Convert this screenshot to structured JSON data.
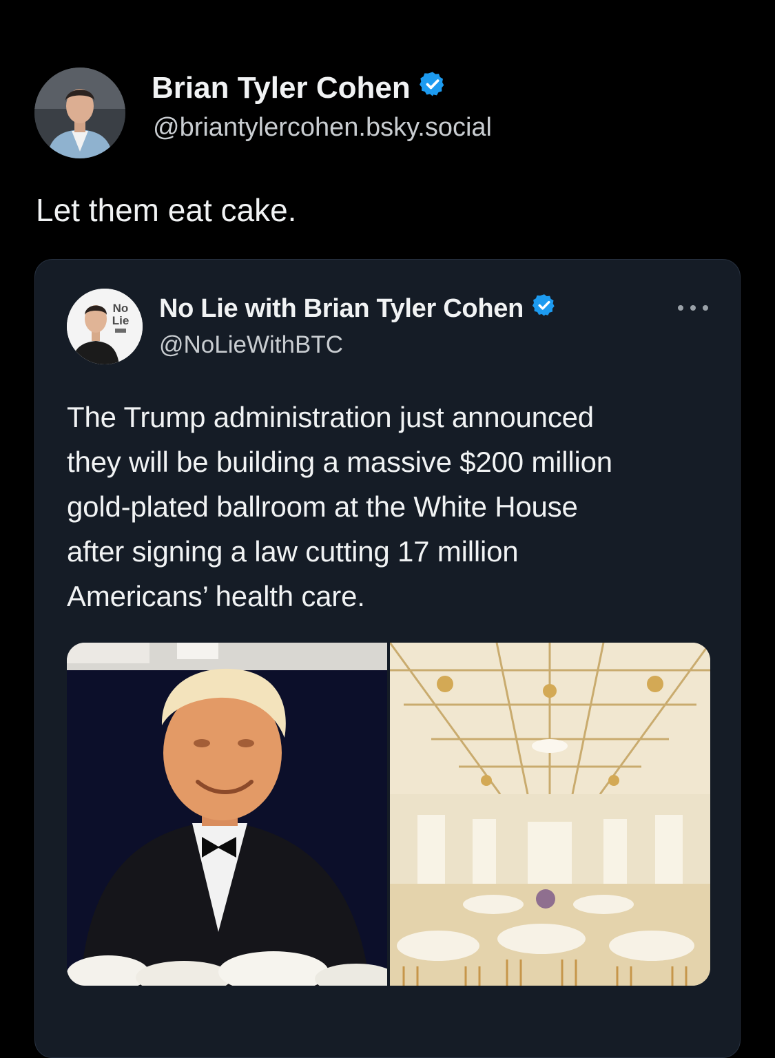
{
  "post": {
    "author": {
      "name": "Brian Tyler Cohen",
      "handle": "@briantylercohen.bsky.social",
      "verified": true,
      "avatar_icon": "profile-photo"
    },
    "text": "Let them eat cake."
  },
  "quoted_post": {
    "author": {
      "name": "No Lie with Brian Tyler Cohen",
      "handle": "@NoLieWithBTC",
      "verified": true,
      "avatar_icon": "no-lie-logo-avatar",
      "avatar_logo_text": "No Lie"
    },
    "more_icon": "more-options-icon",
    "text_lines": [
      "The Trump administration just announced",
      "they will be building a massive $200 million",
      "gold-plated ballroom at the White House",
      "after signing a law cutting 17 million",
      "Americans’ health care."
    ],
    "media": [
      {
        "icon": "photo-man-in-tuxedo"
      },
      {
        "icon": "photo-gold-ballroom"
      }
    ]
  },
  "colors": {
    "background": "#000000",
    "card_background": "#151c26",
    "verified_blue": "#1d9bf0",
    "text_primary": "#f1f3f4",
    "text_secondary": "#c9cdd1"
  }
}
